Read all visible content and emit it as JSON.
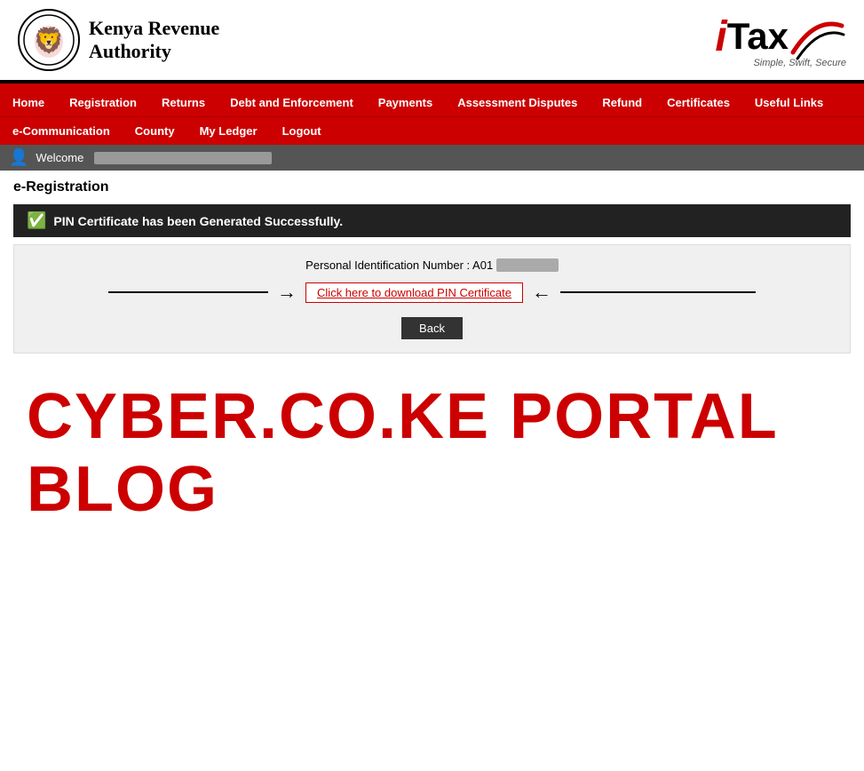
{
  "header": {
    "kra_name_line1": "Kenya Revenue",
    "kra_name_line2": "Authority",
    "itax_i": "i",
    "itax_tax": "Tax",
    "itax_tagline": "Simple, Swift, Secure"
  },
  "nav": {
    "row1": [
      {
        "label": "Home",
        "id": "home"
      },
      {
        "label": "Registration",
        "id": "registration"
      },
      {
        "label": "Returns",
        "id": "returns"
      },
      {
        "label": "Debt and Enforcement",
        "id": "debt"
      },
      {
        "label": "Payments",
        "id": "payments"
      },
      {
        "label": "Assessment Disputes",
        "id": "disputes"
      },
      {
        "label": "Refund",
        "id": "refund"
      },
      {
        "label": "Certificates",
        "id": "certificates"
      },
      {
        "label": "Useful Links",
        "id": "links"
      }
    ],
    "row2": [
      {
        "label": "e-Communication",
        "id": "ecomm"
      },
      {
        "label": "County",
        "id": "county"
      },
      {
        "label": "My Ledger",
        "id": "ledger"
      },
      {
        "label": "Logout",
        "id": "logout"
      }
    ]
  },
  "welcome": {
    "text": "Welcome",
    "blurred_name": "XXXXXXXXXXXXXXXX"
  },
  "page": {
    "title_bold": "e-Registration",
    "title_rest": ""
  },
  "success": {
    "message": "PIN Certificate has been Generated Successfully."
  },
  "pin_section": {
    "label": "Personal Identification Number : A01",
    "blurred_pin": "XXXXXXXX",
    "download_link": "Click here to download PIN Certificate",
    "back_button": "Back"
  },
  "watermark": {
    "text": "CYBER.CO.KE PORTAL BLOG"
  }
}
